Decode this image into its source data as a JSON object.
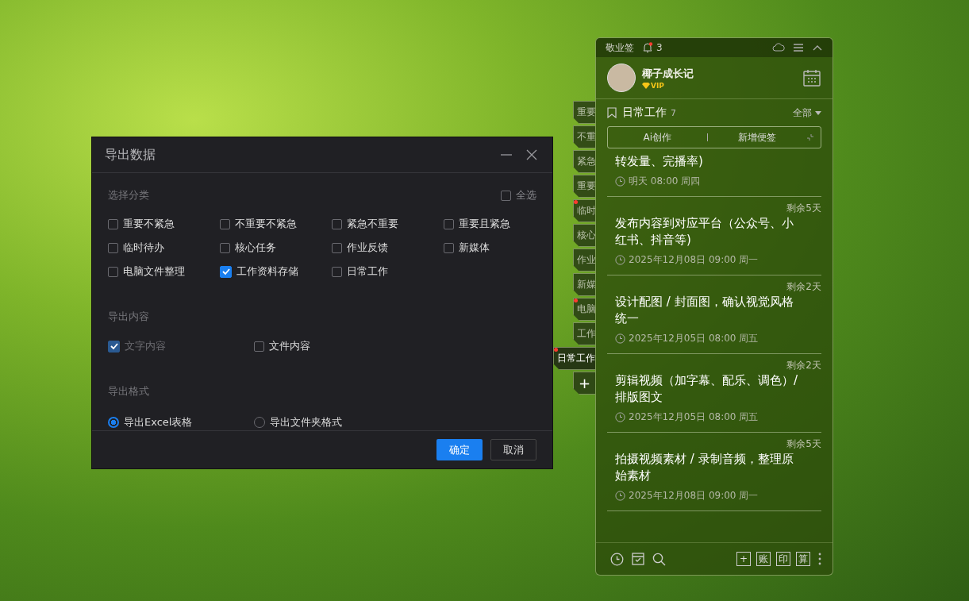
{
  "dialog": {
    "title": "导出数据",
    "category_section": {
      "heading": "选择分类",
      "select_all": {
        "label": "全选",
        "checked": false
      },
      "categories": [
        {
          "label": "重要不紧急",
          "checked": false
        },
        {
          "label": "不重要不紧急",
          "checked": false
        },
        {
          "label": "紧急不重要",
          "checked": false
        },
        {
          "label": "重要且紧急",
          "checked": false
        },
        {
          "label": "临时待办",
          "checked": false
        },
        {
          "label": "核心任务",
          "checked": false
        },
        {
          "label": "作业反馈",
          "checked": false
        },
        {
          "label": "新媒体",
          "checked": false
        },
        {
          "label": "电脑文件整理",
          "checked": false
        },
        {
          "label": "工作资料存储",
          "checked": true
        },
        {
          "label": "日常工作",
          "checked": false
        }
      ]
    },
    "content_section": {
      "heading": "导出内容",
      "options": [
        {
          "label": "文字内容",
          "checked": true,
          "disabled": true
        },
        {
          "label": "文件内容",
          "checked": false,
          "disabled": false
        }
      ]
    },
    "format_section": {
      "heading": "导出格式",
      "options": [
        {
          "label": "导出Excel表格",
          "selected": true
        },
        {
          "label": "导出文件夹格式",
          "selected": false
        }
      ]
    },
    "buttons": [
      {
        "label": "确定",
        "kind": "primary"
      },
      {
        "label": "取消",
        "kind": "secondary"
      }
    ]
  },
  "side_tabs": {
    "tabs": [
      {
        "label": "重要",
        "selected": false,
        "alert": false
      },
      {
        "label": "不重",
        "selected": false,
        "alert": false
      },
      {
        "label": "紧急",
        "selected": false,
        "alert": false
      },
      {
        "label": "重要",
        "selected": false,
        "alert": false
      },
      {
        "label": "临时",
        "selected": false,
        "alert": true
      },
      {
        "label": "核心",
        "selected": false,
        "alert": false
      },
      {
        "label": "作业",
        "selected": false,
        "alert": false
      },
      {
        "label": "新媒",
        "selected": false,
        "alert": false
      },
      {
        "label": "电脑",
        "selected": false,
        "alert": true
      },
      {
        "label": "工作",
        "selected": false,
        "alert": false
      },
      {
        "label": "日常工作",
        "selected": true,
        "alert": true
      }
    ],
    "add_label": "+"
  },
  "widget": {
    "app_name": "敬业签",
    "notification_count": "3",
    "user": {
      "name": "椰子成长记",
      "badge": "VIP"
    },
    "list": {
      "title": "日常工作",
      "count": "7",
      "filter": "全部",
      "actions": [
        "Ai创作",
        "新增便签"
      ]
    },
    "notes": [
      {
        "text": "转发量、完播率)",
        "time": "明天 08:00 周四"
      },
      {
        "remaining": "剩余5天",
        "text": "发布内容到对应平台（公众号、小红书、抖音等)",
        "time": "2025年12月08日 09:00 周一"
      },
      {
        "remaining": "剩余2天",
        "text": "设计配图 / 封面图，确认视觉风格统一",
        "time": "2025年12月05日 08:00 周五"
      },
      {
        "remaining": "剩余2天",
        "text": "剪辑视频（加字幕、配乐、调色）/ 排版图文",
        "time": "2025年12月05日 08:00 周五"
      },
      {
        "remaining": "剩余5天",
        "text": "拍摄视频素材 / 录制音频，整理原始素材",
        "time": "2025年12月08日 09:00 周一"
      }
    ],
    "toolbar_labels": [
      "+",
      "账",
      "印",
      "算"
    ]
  }
}
